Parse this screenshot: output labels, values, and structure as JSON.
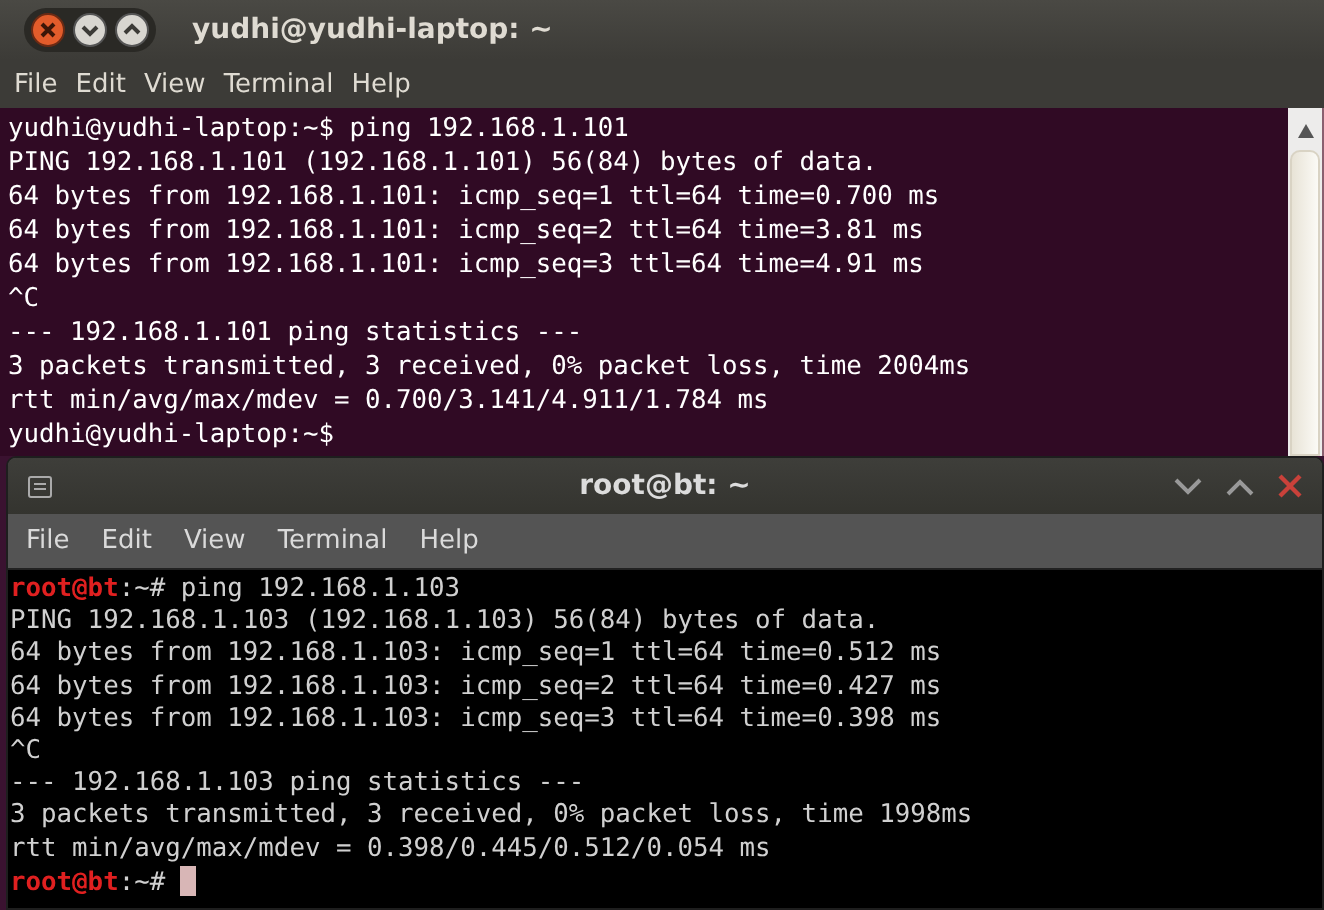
{
  "windows": [
    {
      "kind": "ubuntu",
      "title": "yudhi@yudhi-laptop: ~",
      "menu": [
        "File",
        "Edit",
        "View",
        "Terminal",
        "Help"
      ],
      "lines": [
        {
          "kind": "prompt",
          "prompt": "yudhi@yudhi-laptop",
          "suffix": ":~$ ",
          "command": "ping 192.168.1.101",
          "cursor": false
        },
        {
          "kind": "output",
          "text": "PING 192.168.1.101 (192.168.1.101) 56(84) bytes of data."
        },
        {
          "kind": "output",
          "text": "64 bytes from 192.168.1.101: icmp_seq=1 ttl=64 time=0.700 ms"
        },
        {
          "kind": "output",
          "text": "64 bytes from 192.168.1.101: icmp_seq=2 ttl=64 time=3.81 ms"
        },
        {
          "kind": "output",
          "text": "64 bytes from 192.168.1.101: icmp_seq=3 ttl=64 time=4.91 ms"
        },
        {
          "kind": "output",
          "text": "^C"
        },
        {
          "kind": "output",
          "text": "--- 192.168.1.101 ping statistics ---"
        },
        {
          "kind": "output",
          "text": "3 packets transmitted, 3 received, 0% packet loss, time 2004ms"
        },
        {
          "kind": "output",
          "text": "rtt min/avg/max/mdev = 0.700/3.141/4.911/1.784 ms"
        },
        {
          "kind": "prompt",
          "prompt": "yudhi@yudhi-laptop",
          "suffix": ":~$",
          "cursor": false
        }
      ]
    },
    {
      "kind": "backtrack",
      "title": "root@bt: ~",
      "menu": [
        "File",
        "Edit",
        "View",
        "Terminal",
        "Help"
      ],
      "lines": [
        {
          "kind": "prompt",
          "prompt": "root@bt",
          "suffix": ":~# ",
          "command": "ping 192.168.1.103",
          "cursor": false
        },
        {
          "kind": "output",
          "text": "PING 192.168.1.103 (192.168.1.103) 56(84) bytes of data."
        },
        {
          "kind": "output",
          "text": "64 bytes from 192.168.1.103: icmp_seq=1 ttl=64 time=0.512 ms"
        },
        {
          "kind": "output",
          "text": "64 bytes from 192.168.1.103: icmp_seq=2 ttl=64 time=0.427 ms"
        },
        {
          "kind": "output",
          "text": "64 bytes from 192.168.1.103: icmp_seq=3 ttl=64 time=0.398 ms"
        },
        {
          "kind": "output",
          "text": "^C"
        },
        {
          "kind": "output",
          "text": "--- 192.168.1.103 ping statistics ---"
        },
        {
          "kind": "output",
          "text": "3 packets transmitted, 3 received, 0% packet loss, time 1998ms"
        },
        {
          "kind": "output",
          "text": "rtt min/avg/max/mdev = 0.398/0.445/0.512/0.054 ms"
        },
        {
          "kind": "prompt",
          "prompt": "root@bt",
          "suffix": ":~# ",
          "cursor": true
        }
      ]
    }
  ]
}
